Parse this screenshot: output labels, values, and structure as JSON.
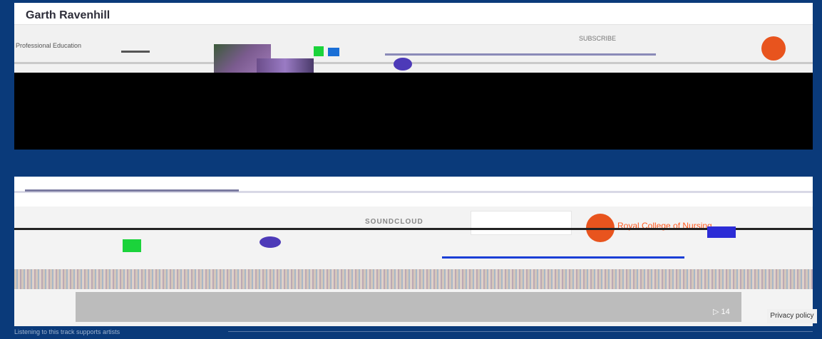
{
  "window": {
    "background": "#0a3a7a"
  },
  "card1": {
    "author_name": "Garth Ravenhill",
    "subscribe_label": "SUBSCRIBE",
    "channel_label": "Professional Education"
  },
  "card2": {
    "soundcloud_label": "SOUNDCLOUD",
    "publisher": "Royal College of Nursing",
    "duration": "▷ 14"
  },
  "footer": {
    "privacy_label": "Privacy policy",
    "caption": "Listening to this track supports artists"
  },
  "colors": {
    "soundcloud_orange": "#ff5500",
    "rcn_orange": "#e8541e",
    "accent_green": "#1bd33b",
    "accent_purple": "#4d3ab8"
  }
}
